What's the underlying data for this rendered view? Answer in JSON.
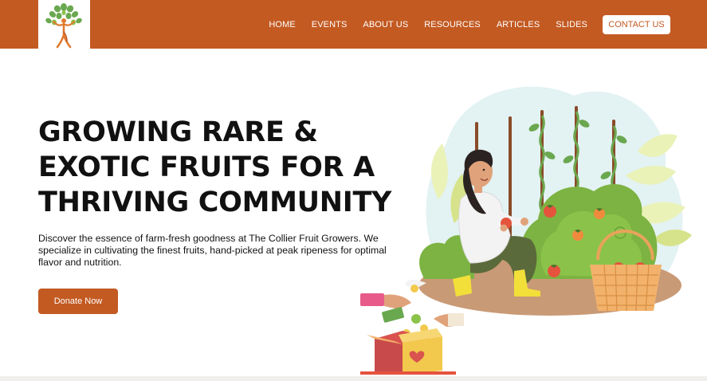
{
  "nav": {
    "links": [
      "HOME",
      "EVENTS",
      "ABOUT US",
      "RESOURCES",
      "ARTICLES",
      "SLIDES"
    ],
    "contact_label": "CONTACT US"
  },
  "hero": {
    "title_lines": [
      "GROWING RARE &",
      "EXOTIC FRUITS FOR A",
      "THRIVING COMMUNITY"
    ],
    "description": "Discover the essence of farm-fresh goodness at The Collier Fruit Growers. We specialize in cultivating the finest fruits, hand-picked at peak ripeness for optimal flavor and nutrition.",
    "donate_label": "Donate Now"
  },
  "colors": {
    "brand": "#c35a22",
    "text": "#111111",
    "background": "#ffffff"
  },
  "icons": {
    "logo": "tree-person-logo",
    "illustration": "farmer-harvest-illustration"
  }
}
